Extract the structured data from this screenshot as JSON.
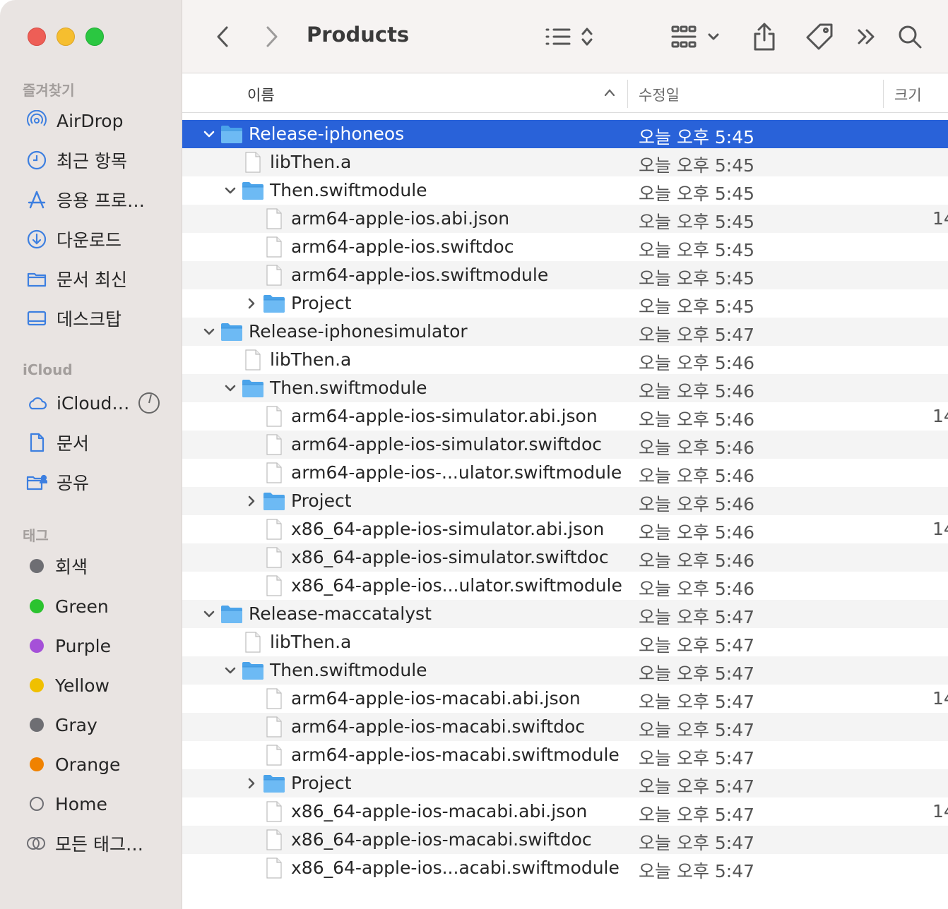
{
  "window": {
    "title": "Products",
    "traffic_lights": [
      "close",
      "minimize",
      "zoom"
    ]
  },
  "sidebar": {
    "favorites_label": "즐겨찾기",
    "favorites": [
      {
        "label": "AirDrop",
        "icon": "airdrop-icon"
      },
      {
        "label": "최근 항목",
        "icon": "clock-icon"
      },
      {
        "label": "응용 프로…",
        "icon": "applications-icon"
      },
      {
        "label": "다운로드",
        "icon": "download-icon"
      },
      {
        "label": "문서 최신",
        "icon": "folder-icon"
      },
      {
        "label": "데스크탑",
        "icon": "desktop-icon"
      }
    ],
    "icloud_label": "iCloud",
    "icloud": [
      {
        "label": "iCloud…",
        "icon": "cloud-icon"
      },
      {
        "label": "문서",
        "icon": "document-icon"
      },
      {
        "label": "공유",
        "icon": "shared-folder-icon"
      }
    ],
    "tags_label": "태그",
    "tags": [
      {
        "label": "회색",
        "color": "#6e6e73"
      },
      {
        "label": "Green",
        "color": "#2bc32f"
      },
      {
        "label": "Purple",
        "color": "#a550d8"
      },
      {
        "label": "Yellow",
        "color": "#f0c000"
      },
      {
        "label": "Gray",
        "color": "#6e6e73"
      },
      {
        "label": "Orange",
        "color": "#f08200"
      },
      {
        "label": "Home",
        "color": "none"
      },
      {
        "label": "모든 태그…",
        "color": "all"
      }
    ]
  },
  "toolbar": {
    "back": "back-icon",
    "forward": "forward-icon",
    "view_mode": "list-view-icon",
    "group": "group-icon",
    "share": "share-icon",
    "tag": "tag-icon",
    "more": "more-icon",
    "search": "search-icon"
  },
  "columns": {
    "name": "이름",
    "date": "수정일",
    "size": "크기"
  },
  "rows": [
    {
      "name": "Release-iphoneos",
      "date": "오늘 오후 5:45",
      "size": "",
      "level": 0,
      "type": "folder",
      "expanded": true,
      "selected": true
    },
    {
      "name": "libThen.a",
      "date": "오늘 오후 5:45",
      "size": "",
      "level": 1,
      "type": "file"
    },
    {
      "name": "Then.swiftmodule",
      "date": "오늘 오후 5:45",
      "size": "",
      "level": 1,
      "type": "folder",
      "expanded": true
    },
    {
      "name": "arm64-apple-ios.abi.json",
      "date": "오늘 오후 5:45",
      "size": "14",
      "level": 2,
      "type": "file"
    },
    {
      "name": "arm64-apple-ios.swiftdoc",
      "date": "오늘 오후 5:45",
      "size": "",
      "level": 2,
      "type": "file"
    },
    {
      "name": "arm64-apple-ios.swiftmodule",
      "date": "오늘 오후 5:45",
      "size": "",
      "level": 2,
      "type": "file"
    },
    {
      "name": "Project",
      "date": "오늘 오후 5:45",
      "size": "",
      "level": 2,
      "type": "folder",
      "expanded": false
    },
    {
      "name": "Release-iphonesimulator",
      "date": "오늘 오후 5:47",
      "size": "",
      "level": 0,
      "type": "folder",
      "expanded": true
    },
    {
      "name": "libThen.a",
      "date": "오늘 오후 5:46",
      "size": "",
      "level": 1,
      "type": "file"
    },
    {
      "name": "Then.swiftmodule",
      "date": "오늘 오후 5:46",
      "size": "",
      "level": 1,
      "type": "folder",
      "expanded": true
    },
    {
      "name": "arm64-apple-ios-simulator.abi.json",
      "date": "오늘 오후 5:46",
      "size": "14",
      "level": 2,
      "type": "file"
    },
    {
      "name": "arm64-apple-ios-simulator.swiftdoc",
      "date": "오늘 오후 5:46",
      "size": "",
      "level": 2,
      "type": "file"
    },
    {
      "name": "arm64-apple-ios-...ulator.swiftmodule",
      "date": "오늘 오후 5:46",
      "size": "",
      "level": 2,
      "type": "file"
    },
    {
      "name": "Project",
      "date": "오늘 오후 5:46",
      "size": "",
      "level": 2,
      "type": "folder",
      "expanded": false
    },
    {
      "name": "x86_64-apple-ios-simulator.abi.json",
      "date": "오늘 오후 5:46",
      "size": "14",
      "level": 2,
      "type": "file"
    },
    {
      "name": "x86_64-apple-ios-simulator.swiftdoc",
      "date": "오늘 오후 5:46",
      "size": "",
      "level": 2,
      "type": "file"
    },
    {
      "name": "x86_64-apple-ios...ulator.swiftmodule",
      "date": "오늘 오후 5:46",
      "size": "",
      "level": 2,
      "type": "file"
    },
    {
      "name": "Release-maccatalyst",
      "date": "오늘 오후 5:47",
      "size": "",
      "level": 0,
      "type": "folder",
      "expanded": true
    },
    {
      "name": "libThen.a",
      "date": "오늘 오후 5:47",
      "size": "",
      "level": 1,
      "type": "file"
    },
    {
      "name": "Then.swiftmodule",
      "date": "오늘 오후 5:47",
      "size": "",
      "level": 1,
      "type": "folder",
      "expanded": true
    },
    {
      "name": "arm64-apple-ios-macabi.abi.json",
      "date": "오늘 오후 5:47",
      "size": "14",
      "level": 2,
      "type": "file"
    },
    {
      "name": "arm64-apple-ios-macabi.swiftdoc",
      "date": "오늘 오후 5:47",
      "size": "",
      "level": 2,
      "type": "file"
    },
    {
      "name": "arm64-apple-ios-macabi.swiftmodule",
      "date": "오늘 오후 5:47",
      "size": "",
      "level": 2,
      "type": "file"
    },
    {
      "name": "Project",
      "date": "오늘 오후 5:47",
      "size": "",
      "level": 2,
      "type": "folder",
      "expanded": false
    },
    {
      "name": "x86_64-apple-ios-macabi.abi.json",
      "date": "오늘 오후 5:47",
      "size": "14",
      "level": 2,
      "type": "file"
    },
    {
      "name": "x86_64-apple-ios-macabi.swiftdoc",
      "date": "오늘 오후 5:47",
      "size": "",
      "level": 2,
      "type": "file"
    },
    {
      "name": "x86_64-apple-ios...acabi.swiftmodule",
      "date": "오늘 오후 5:47",
      "size": "",
      "level": 2,
      "type": "file"
    }
  ],
  "colors": {
    "selection": "#2962d9",
    "sidebar_bg": "#e9e4e2",
    "folder": "#5aaef0"
  }
}
